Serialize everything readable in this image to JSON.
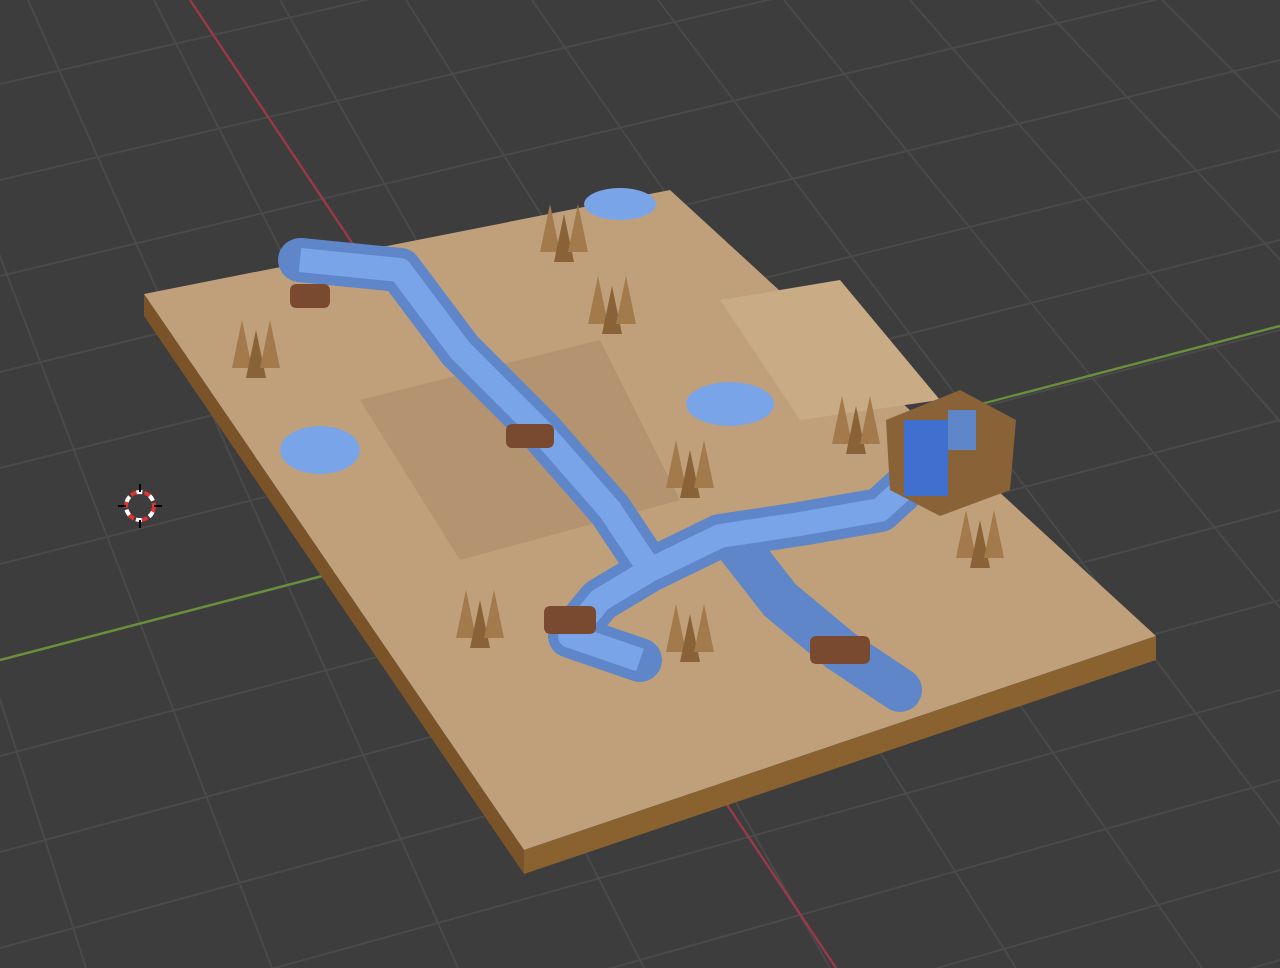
{
  "viewport": {
    "grid": true,
    "axes": true,
    "cursor": true
  }
}
